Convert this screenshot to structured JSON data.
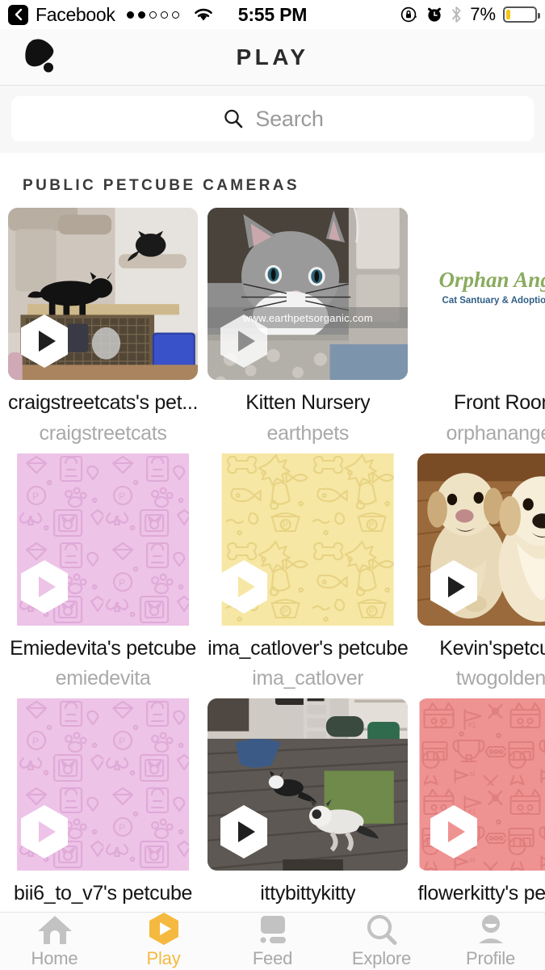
{
  "status_bar": {
    "back_label": "Facebook",
    "back_icon": "chevron-left-icon",
    "signal_dots": [
      true,
      true,
      false,
      false,
      false
    ],
    "wifi_icon": "wifi-icon",
    "time": "5:55 PM",
    "rotation_lock_icon": "rotation-lock-icon",
    "alarm_icon": "alarm-clock-icon",
    "bluetooth_icon": "bluetooth-icon",
    "battery_percent": "7%",
    "battery_level": 7,
    "battery_color": "#f5c518"
  },
  "navbar": {
    "logo_icon": "petcube-logo-icon",
    "title": "PLAY"
  },
  "search": {
    "icon": "search-icon",
    "placeholder": "Search",
    "value": ""
  },
  "section": {
    "title": "PUBLIC PETCUBE CAMERAS"
  },
  "cards": [
    {
      "title": "craigstreetcats's pet...",
      "subtitle": "craigstreetcats",
      "thumb_type": "photo-cats-shelter",
      "has_play": true,
      "watermark": ""
    },
    {
      "title": "Kitten Nursery",
      "subtitle": "earthpets",
      "thumb_type": "photo-kitten",
      "has_play": true,
      "watermark": "www.earthpetsorganic.com"
    },
    {
      "title": "Front Room",
      "subtitle": "orphanangels",
      "thumb_type": "logo-orphan-angels",
      "has_play": false,
      "watermark": "",
      "logo_line1": "Orphan Angels",
      "logo_line2": "Cat Santuary & Adoption Center",
      "logo_color": "#8aab5e"
    },
    {
      "title": "Emiedevita's petcube",
      "subtitle": "emiedevita",
      "thumb_type": "pattern-pink",
      "has_play": true,
      "watermark": "",
      "bg_color": "#edc3e7"
    },
    {
      "title": "ima_catlover's petcube",
      "subtitle": "ima_catlover",
      "thumb_type": "pattern-yellow",
      "has_play": true,
      "watermark": "",
      "bg_color": "#f6e7a4"
    },
    {
      "title": "Kevin'spetcube",
      "subtitle": "twogoldens",
      "thumb_type": "photo-golden-retrievers",
      "has_play": true,
      "watermark": ""
    },
    {
      "title": "bii6_to_v7's petcube",
      "subtitle": "",
      "thumb_type": "pattern-pink",
      "has_play": true,
      "watermark": "",
      "bg_color": "#edc3e7"
    },
    {
      "title": "ittybittykitty",
      "subtitle": "",
      "thumb_type": "photo-room-cats",
      "has_play": true,
      "watermark": ""
    },
    {
      "title": "flowerkitty's petcube",
      "subtitle": "",
      "thumb_type": "pattern-salmon",
      "has_play": true,
      "watermark": "",
      "bg_color": "#ef9292"
    }
  ],
  "tabbar": {
    "active_color": "#f5b940",
    "inactive_color": "#c2c2c2",
    "items": [
      {
        "label": "Home",
        "icon": "home-icon",
        "active": false
      },
      {
        "label": "Play",
        "icon": "play-hexagon-icon",
        "active": true
      },
      {
        "label": "Feed",
        "icon": "feed-icon",
        "active": false
      },
      {
        "label": "Explore",
        "icon": "search-magnifier-icon",
        "active": false
      },
      {
        "label": "Profile",
        "icon": "person-icon",
        "active": false
      }
    ]
  }
}
